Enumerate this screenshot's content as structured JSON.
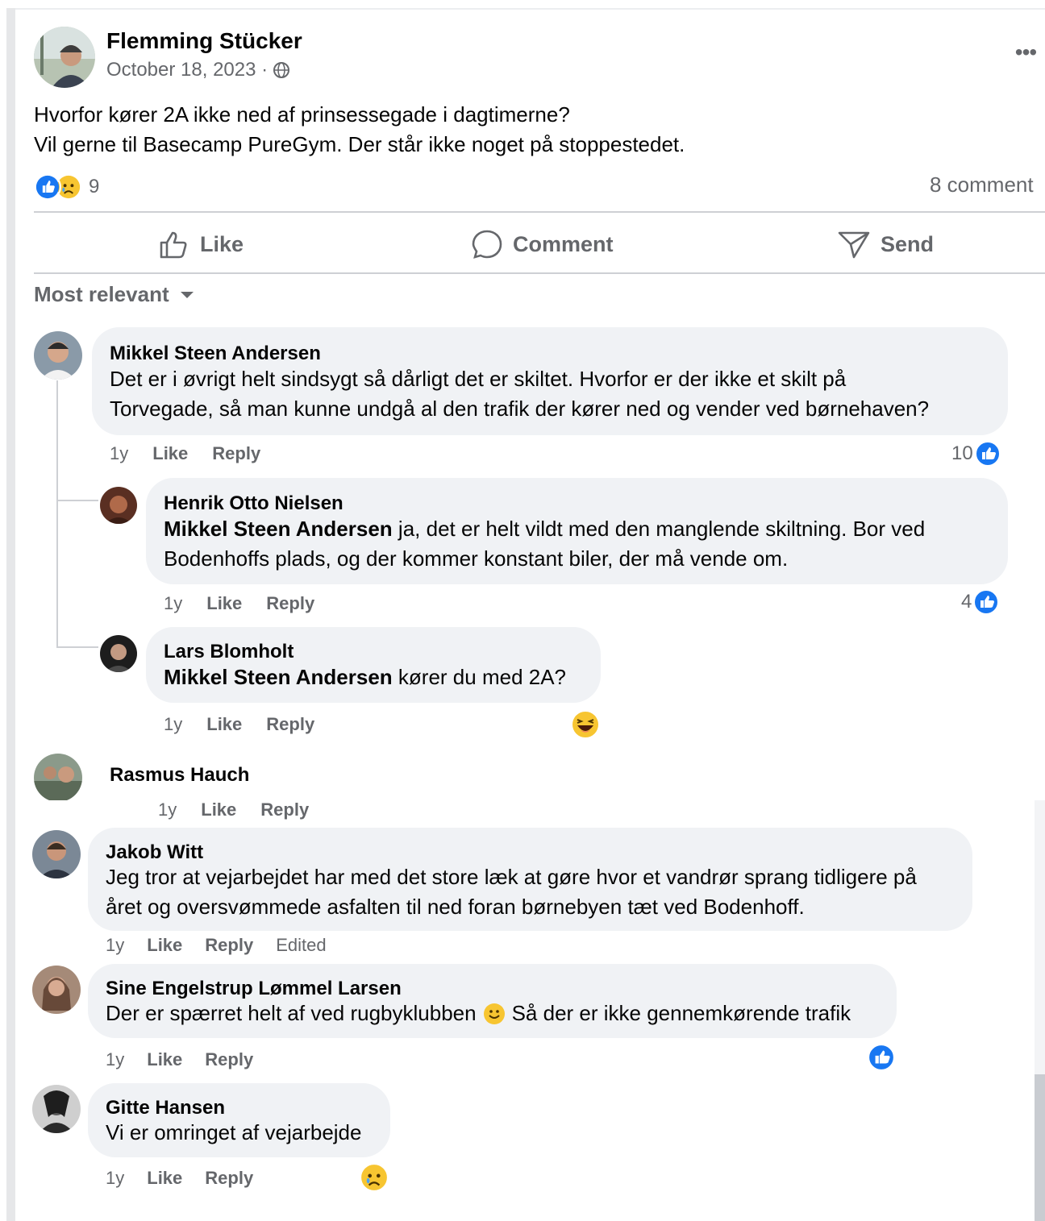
{
  "post": {
    "author": "Flemming Stücker",
    "date": "October 18, 2023 ·",
    "more_label": "•••",
    "text_line1": "Hvorfor kører 2A ikke ned af prinsessegade i dagtimerne?",
    "text_line2": "Vil gerne til Basecamp PureGym. Der står ikke noget på stoppestedet.",
    "reaction_icons": [
      "like-icon",
      "sad-icon"
    ],
    "reaction_count": "9",
    "comment_count": "8 comment"
  },
  "actions": {
    "like": "Like",
    "comment": "Comment",
    "send": "Send"
  },
  "sort": {
    "label": "Most relevant"
  },
  "comments": [
    {
      "name": "Mikkel Steen Andersen",
      "line1": "Det er i øvrigt helt sindsygt så dårligt det er skiltet. Hvorfor er der ikke et skilt på",
      "line2": "Torvegade, så man kunne undgå al den trafik der kører ned og vender ved børnehaven?",
      "time": "1y",
      "like": "Like",
      "reply": "Reply",
      "like_count": "10"
    },
    {
      "name": "Henrik Otto Nielsen",
      "mention": "Mikkel Steen Andersen",
      "line1": " ja, det er helt vildt med den manglende skiltning. Bor ved",
      "line2": "Bodenhoffs plads, og der kommer konstant biler, der må vende om.",
      "time": "1y",
      "like": "Like",
      "reply": "Reply",
      "like_count": "4"
    },
    {
      "name": "Lars Blomholt",
      "mention": "Mikkel Steen Andersen",
      "line1": " kører du med 2A?",
      "time": "1y",
      "like": "Like",
      "reply": "Reply",
      "reaction": "haha-icon"
    },
    {
      "name": "Rasmus Hauch"
    },
    {
      "time": "1y",
      "like": "Like",
      "reply": "Reply"
    },
    {
      "name": "Jakob Witt",
      "line1": "Jeg tror at vejarbejdet har med det store læk at gøre hvor et vandrør sprang tidligere på",
      "line2": "året og oversvømmede asfalten til ned foran børnebyen tæt ved Bodenhoff.",
      "time": "1y",
      "like": "Like",
      "reply": "Reply",
      "edited": "Edited"
    },
    {
      "name": "Sine Engelstrup Lømmel Larsen",
      "line1_a": "Der er spærret helt af ved rugbyklubben",
      "line1_b": "Så der er ikke gennemkørende trafik",
      "time": "1y",
      "like": "Like",
      "reply": "Reply",
      "reaction": "like-icon"
    },
    {
      "name": "Gitte Hansen",
      "line1": "Vi er omringet af vejarbejde",
      "time": "1y",
      "like": "Like",
      "reply": "Reply",
      "reaction": "sad-icon"
    }
  ],
  "colors": {
    "facebook_blue": "#1877f2",
    "bubble_bg": "#f0f2f5",
    "secondary_text": "#65676b",
    "divider": "#ced0d4",
    "emoji_yellow": "#f7c531"
  }
}
